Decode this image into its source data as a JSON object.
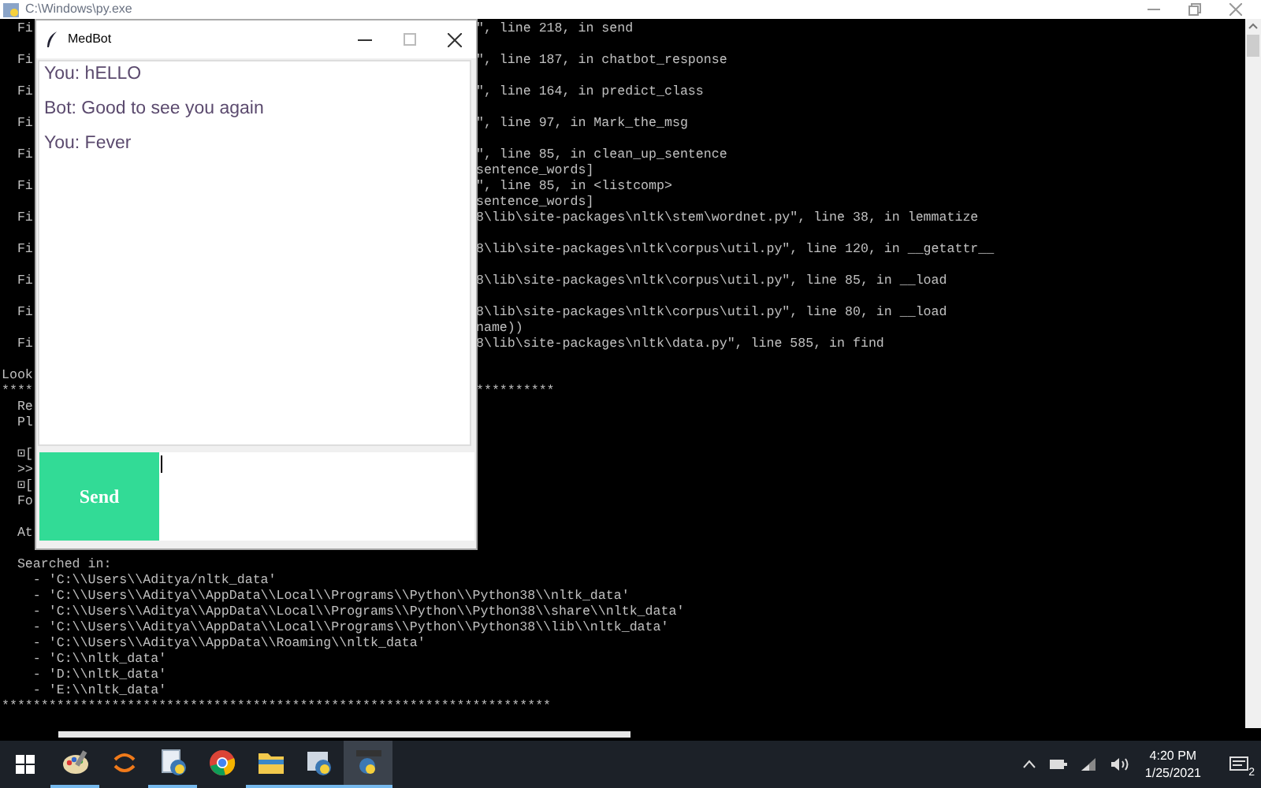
{
  "console": {
    "title": "C:\\Windows\\py.exe",
    "lines": [
      {
        "left": "  Fi",
        "right": "\", line 218, in send",
        "space_after": true
      },
      {
        "left": "  Fi",
        "right": "\", line 187, in chatbot_response",
        "space_after": true
      },
      {
        "left": "  Fi",
        "right": "\", line 164, in predict_class",
        "space_after": true
      },
      {
        "left": "  Fi",
        "right": "\", line 97, in Mark_the_msg",
        "space_after": true
      },
      {
        "left": "  Fi",
        "right": "\", line 85, in clean_up_sentence",
        "space_after": false
      },
      {
        "right": "sentence_words]",
        "space_after": false
      },
      {
        "left": "  Fi",
        "right": "\", line 85, in <listcomp>",
        "space_after": false
      },
      {
        "right": "sentence_words]",
        "space_after": false
      },
      {
        "left": "  Fi",
        "right": "8\\lib\\site-packages\\nltk\\stem\\wordnet.py\", line 38, in lemmatize",
        "space_after": true
      },
      {
        "left": "  Fi",
        "right": "8\\lib\\site-packages\\nltk\\corpus\\util.py\", line 120, in __getattr__",
        "space_after": true
      },
      {
        "left": "  Fi",
        "right": "8\\lib\\site-packages\\nltk\\corpus\\util.py\", line 85, in __load",
        "space_after": true
      },
      {
        "left": "  Fi",
        "right": "8\\lib\\site-packages\\nltk\\corpus\\util.py\", line 80, in __load",
        "space_after": false
      },
      {
        "right": "name))",
        "space_after": false
      },
      {
        "left": "  Fi",
        "right": "8\\lib\\site-packages\\nltk\\data.py\", line 585, in find",
        "space_after": true
      },
      {
        "left": "Look",
        "space_after": false
      },
      {
        "left": "****",
        "right": "**********",
        "space_after": false
      },
      {
        "left": "  Re",
        "space_after": false
      },
      {
        "left": "  Pl",
        "space_after": true
      },
      {
        "left": "  ⊡[",
        "space_after": false
      },
      {
        "left": "  >>",
        "space_after": false
      },
      {
        "left": "  ⊡[",
        "space_after": false
      },
      {
        "left": "  Fo",
        "space_after": true
      },
      {
        "left": "  At",
        "space_after": true
      },
      {
        "left": "  Searched in:",
        "space_after": false
      },
      {
        "left": "    - 'C:\\\\Users\\\\Aditya/nltk_data'",
        "space_after": false
      },
      {
        "left": "    - 'C:\\\\Users\\\\Aditya\\\\AppData\\\\Local\\\\Programs\\\\Python\\\\Python38\\\\nltk_data'",
        "space_after": false
      },
      {
        "left": "    - 'C:\\\\Users\\\\Aditya\\\\AppData\\\\Local\\\\Programs\\\\Python\\\\Python38\\\\share\\\\nltk_data'",
        "space_after": false
      },
      {
        "left": "    - 'C:\\\\Users\\\\Aditya\\\\AppData\\\\Local\\\\Programs\\\\Python\\\\Python38\\\\lib\\\\nltk_data'",
        "space_after": false
      },
      {
        "left": "    - 'C:\\\\Users\\\\Aditya\\\\AppData\\\\Roaming\\\\nltk_data'",
        "space_after": false
      },
      {
        "left": "    - 'C:\\\\nltk_data'",
        "space_after": false
      },
      {
        "left": "    - 'D:\\\\nltk_data'",
        "space_after": false
      },
      {
        "left": "    - 'E:\\\\nltk_data'",
        "space_after": false
      },
      {
        "left": "**********************************************************************",
        "space_after": false
      }
    ]
  },
  "medbot": {
    "title": "MedBot",
    "messages": [
      "You: hELLO",
      "Bot: Good to see you again",
      "You: Fever"
    ],
    "send_button": "Send"
  },
  "taskbar": {
    "apps": [
      {
        "kind": "paint",
        "running": true,
        "selected": false
      },
      {
        "kind": "sync",
        "running": false,
        "selected": false
      },
      {
        "kind": "python-file",
        "running": true,
        "selected": false
      },
      {
        "kind": "browser",
        "running": false,
        "selected": false
      },
      {
        "kind": "folder",
        "running": true,
        "selected": false
      },
      {
        "kind": "python-idle",
        "running": true,
        "selected": false
      },
      {
        "kind": "python-console",
        "running": true,
        "selected": true
      }
    ],
    "time": "4:20 PM",
    "date": "1/25/2021",
    "notification_count": "2"
  }
}
